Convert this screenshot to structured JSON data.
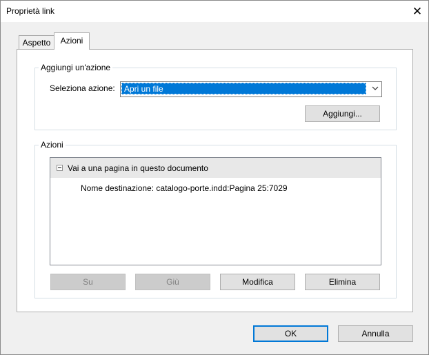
{
  "window": {
    "title": "Proprietà link",
    "close_symbol": "✕"
  },
  "tabs": [
    {
      "label": "Aspetto",
      "selected": false
    },
    {
      "label": "Azioni",
      "selected": true
    }
  ],
  "add_action": {
    "legend": "Aggiungi un'azione",
    "select_label": "Seleziona azione:",
    "select_value": "Apri un file",
    "add_button": "Aggiungi..."
  },
  "actions": {
    "legend": "Azioni",
    "items": [
      {
        "title": "Vai a una pagina in questo documento",
        "detail": "Nome destinazione: catalogo-porte.indd:Pagina 25:7029",
        "expanded": true
      }
    ],
    "buttons": {
      "up": "Su",
      "down": "Giù",
      "edit": "Modifica",
      "delete": "Elimina"
    }
  },
  "footer": {
    "ok": "OK",
    "cancel": "Annulla"
  },
  "colors": {
    "selection": "#0078d7",
    "button_face": "#e1e1e1",
    "dialog_bg": "#f0f0f0"
  }
}
